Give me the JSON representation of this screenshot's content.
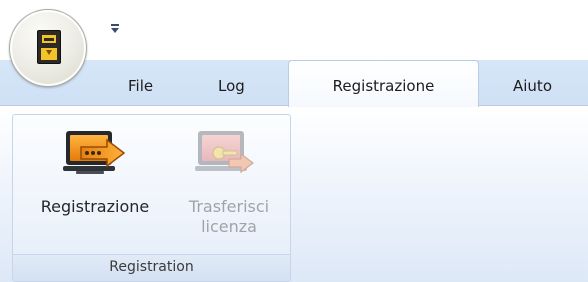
{
  "quick_access": {
    "app_icon": "app-orb-icon",
    "menu_icon": "quick-access-menu-icon"
  },
  "tabs": {
    "file": "File",
    "log": "Log",
    "registrazione": "Registrazione",
    "aiuto": "Aiuto"
  },
  "ribbon": {
    "group_label": "Registration",
    "buttons": {
      "register": {
        "label": "Registrazione",
        "icon": "monitor-arrow-icon"
      },
      "transfer": {
        "label_line1": "Trasferisci",
        "label_line2": "licenza",
        "icon": "monitor-key-arrow-icon",
        "state": "disabled"
      }
    }
  },
  "colors": {
    "accent_orange": "#ef8f1a",
    "active_tab": "#ffffff",
    "tab_strip": "#d6e6f8",
    "disabled_text": "#9fa4ab"
  }
}
